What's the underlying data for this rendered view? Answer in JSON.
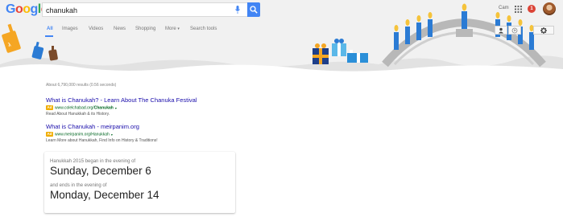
{
  "header": {
    "logo_letters": [
      "G",
      "o",
      "o",
      "g",
      "l",
      "e"
    ],
    "search": {
      "value": "chanukah",
      "placeholder": ""
    },
    "user_name": "Cam",
    "notification_count": "1",
    "icons": [
      "mic-icon",
      "search-icon",
      "apps-icon",
      "avatar",
      "person-icon",
      "globe-icon",
      "gear-icon"
    ]
  },
  "tabs": [
    {
      "label": "All",
      "active": true
    },
    {
      "label": "Images"
    },
    {
      "label": "Videos"
    },
    {
      "label": "News"
    },
    {
      "label": "Shopping"
    },
    {
      "label": "More",
      "caret": "▾"
    },
    {
      "label": "Search tools"
    }
  ],
  "results": {
    "stats": "About 6,790,000 results (0.56 seconds)",
    "ads": [
      {
        "title": "What is Chanukah? - Learn About The Chanuka Festival",
        "badge": "Ad",
        "url_prefix": "www.colelchabad.org/",
        "url_tail": "Chanukah",
        "caret": "▾",
        "description": "Read About Hanukkah & its History."
      },
      {
        "title": "What is Chanukah - meirpanim.org",
        "badge": "Ad",
        "url_prefix": "www.meirpanim.org/Hanukkah",
        "url_tail": "",
        "caret": "▾",
        "description": "Learn More about Hanukkah, Find Info on History & Traditions!"
      }
    ]
  },
  "answer_card": {
    "start_label": "Hanukkah 2015 began in the evening of",
    "start_date": "Sunday, December 6",
    "end_label": "and ends in the evening of",
    "end_date": "Monday, December 14"
  },
  "colors": {
    "accent": "#4285f4",
    "link": "#1a0dab",
    "url_green": "#006621",
    "ad_badge": "#f0ad00",
    "notification": "#db4437"
  }
}
